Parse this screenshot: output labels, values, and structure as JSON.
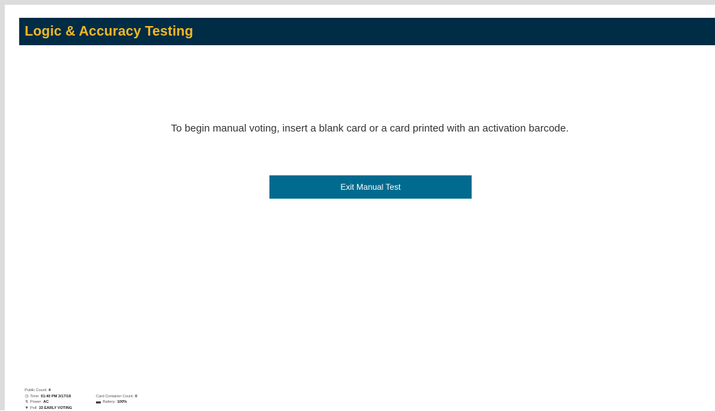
{
  "header": {
    "title": "Logic & Accuracy Testing"
  },
  "main": {
    "instruction": "To begin manual voting, insert a blank card or a card printed with an activation barcode.",
    "exit_button_label": "Exit Manual Test"
  },
  "status": {
    "public_count_label": "Public Count:",
    "public_count_value": "4",
    "time_label": "Time:",
    "time_value": "01:40 PM 3/17/18",
    "power_label": "Power:",
    "power_value": "AC",
    "poll_label": "Poll:",
    "poll_value": "33 EARLY VOTING",
    "card_container_label": "Card Container Count:",
    "card_container_value": "0",
    "battery_label": "Battery:",
    "battery_value": "100%",
    "icons": {
      "time": "clock-icon",
      "power": "plug-icon",
      "poll": "location-pin-icon",
      "battery": "battery-icon"
    }
  },
  "colors": {
    "header_bg": "#002c46",
    "header_text": "#f2b824",
    "button_bg": "#006b8e",
    "button_text": "#ffffff"
  }
}
